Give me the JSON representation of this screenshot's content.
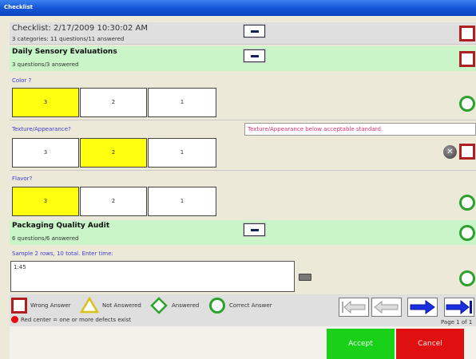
{
  "window": {
    "title": "Checklist"
  },
  "header": {
    "title": "Checklist: 2/17/2009 10:30:02 AM",
    "summary": "3 categories: 11 questions/11 answered"
  },
  "categories": [
    {
      "title": "Daily Sensory Evaluations",
      "summary": "3 questions/3 answered"
    },
    {
      "title": "Packaging Quality Audit",
      "summary": "6 questions/6 answered"
    }
  ],
  "questions": [
    {
      "label": "Color ?",
      "options": [
        "3",
        "2",
        "1"
      ],
      "selected": "3",
      "status": "correct"
    },
    {
      "label": "Texture/Appearance?",
      "options": [
        "3",
        "2",
        "1"
      ],
      "selected": "2",
      "status": "wrong",
      "comment": "Texture/Appearance below acceptable standard."
    },
    {
      "label": "Flavor?",
      "options": [
        "3",
        "2",
        "1"
      ],
      "selected": "3",
      "status": "correct"
    },
    {
      "label": "Sample 2 rows, 10 total. Enter time:",
      "value": "1:45",
      "status": "correct"
    }
  ],
  "legend": {
    "wrong": "Wrong Answer",
    "not_answered": "Not Answered",
    "answered": "Answered",
    "correct": "Correct Answer",
    "defects_note": "Red center = one or more defects exist"
  },
  "pager": {
    "text": "Page 1 of 1"
  },
  "actions": {
    "accept": "Accept",
    "cancel": "Cancel"
  },
  "colors": {
    "title_bar": "#1456d6",
    "category_bg": "#c9f5c9",
    "selected_option": "#ffff10",
    "wrong": "#b01f1f",
    "correct": "#2ca12c",
    "accept": "#1ad11a",
    "cancel": "#e01010",
    "question_label": "#3b3bd0",
    "comment_text": "#e03070"
  }
}
